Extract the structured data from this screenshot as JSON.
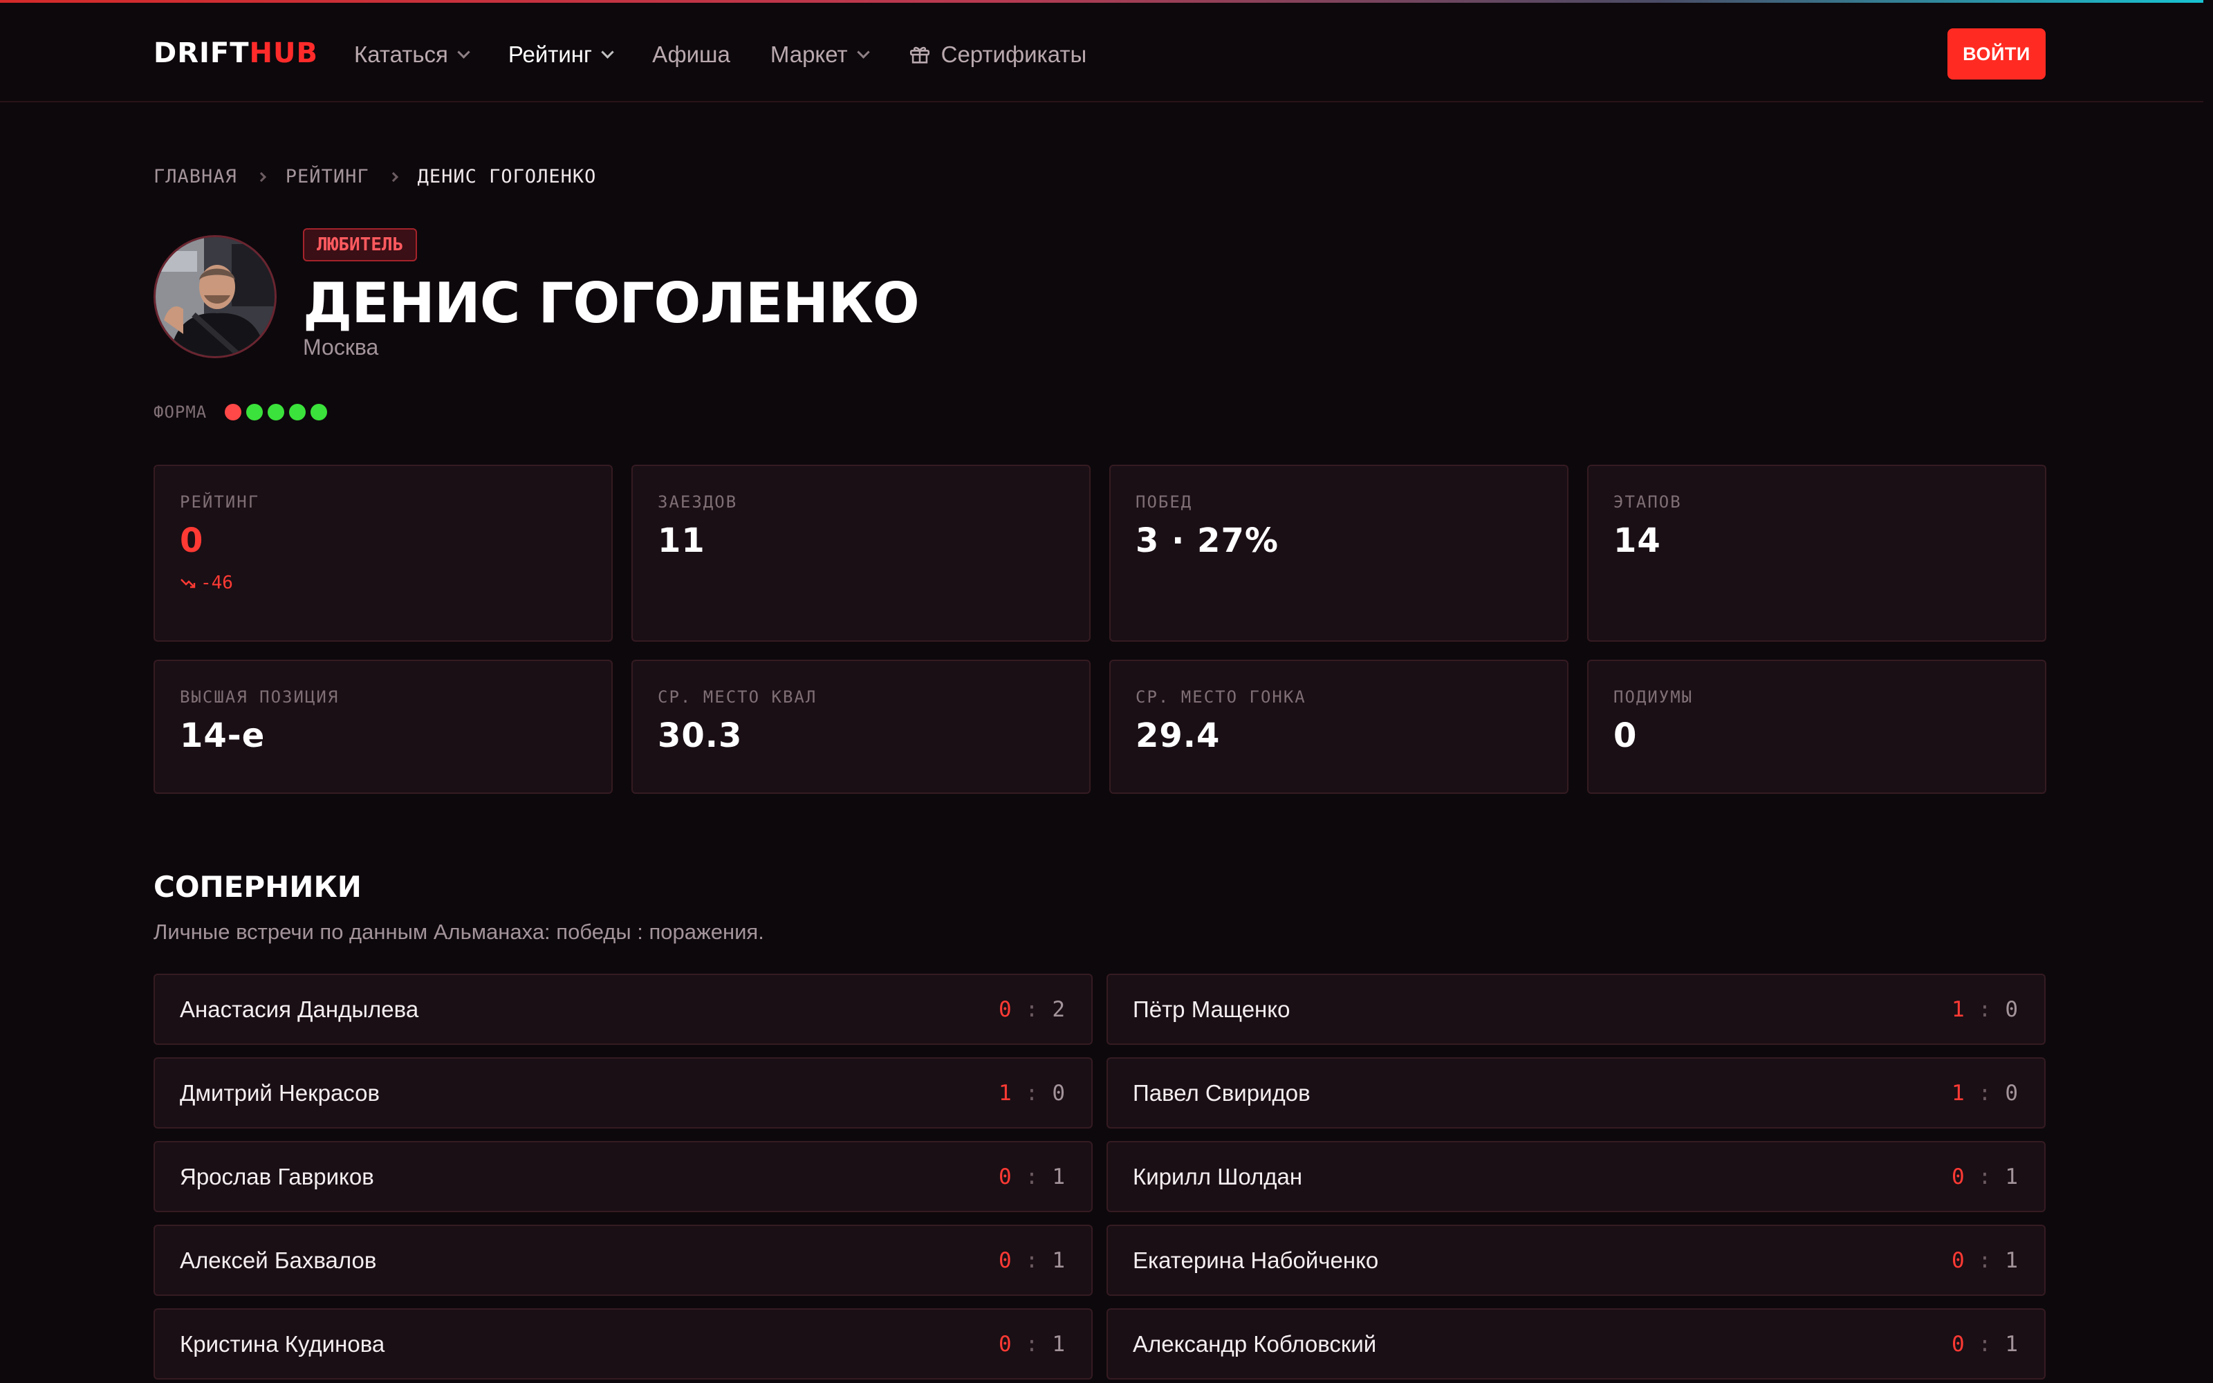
{
  "header": {
    "logo_part1": "DRIFT",
    "logo_part2": "HUB",
    "nav": [
      {
        "label": "Кататься",
        "dropdown": true
      },
      {
        "label": "Рейтинг",
        "dropdown": true,
        "active": true
      },
      {
        "label": "Афиша",
        "dropdown": false
      },
      {
        "label": "Маркет",
        "dropdown": true
      },
      {
        "label": "Сертификаты",
        "icon": "gift-icon"
      }
    ],
    "login_label": "ВОЙТИ"
  },
  "breadcrumb": [
    "ГЛАВНАЯ",
    "РЕЙТИНГ",
    "ДЕНИС ГОГОЛЕНКО"
  ],
  "profile": {
    "badge": "ЛЮБИТЕЛЬ",
    "name": "ДЕНИС ГОГОЛЕНКО",
    "city": "Москва",
    "form_label": "ФОРМА",
    "form": [
      "L",
      "W",
      "W",
      "W",
      "W"
    ]
  },
  "stats": [
    {
      "label": "РЕЙТИНГ",
      "value": "0",
      "accent": true,
      "delta": "-46"
    },
    {
      "label": "ЗАЕЗДОВ",
      "value": "11"
    },
    {
      "label": "ПОБЕД",
      "value": "3 · 27%"
    },
    {
      "label": "ЭТАПОВ",
      "value": "14"
    },
    {
      "label": "ВЫСШАЯ ПОЗИЦИЯ",
      "value": "14-е"
    },
    {
      "label": "СР. МЕСТО КВАЛ",
      "value": "30.3"
    },
    {
      "label": "СР. МЕСТО ГОНКА",
      "value": "29.4"
    },
    {
      "label": "ПОДИУМЫ",
      "value": "0"
    }
  ],
  "rivals_section": {
    "title": "СОПЕРНИКИ",
    "subtitle": "Личные встречи по данным Альманаха: победы : поражения."
  },
  "rivals": [
    {
      "name": "Анастасия Дандылева",
      "wins": "0",
      "losses": "2"
    },
    {
      "name": "Пётр Мащенко",
      "wins": "1",
      "losses": "0"
    },
    {
      "name": "Дмитрий Некрасов",
      "wins": "1",
      "losses": "0"
    },
    {
      "name": "Павел Свиридов",
      "wins": "1",
      "losses": "0"
    },
    {
      "name": "Ярослав Гавриков",
      "wins": "0",
      "losses": "1"
    },
    {
      "name": "Кирилл Шолдан",
      "wins": "0",
      "losses": "1"
    },
    {
      "name": "Алексей Бахвалов",
      "wins": "0",
      "losses": "1"
    },
    {
      "name": "Екатерина Набойченко",
      "wins": "0",
      "losses": "1"
    },
    {
      "name": "Кристина Кудинова",
      "wins": "0",
      "losses": "1"
    },
    {
      "name": "Александр Кобловский",
      "wins": "0",
      "losses": "1"
    }
  ],
  "colors": {
    "accent": "#ff2b22",
    "win": "#3be23b",
    "loss": "#ff4848",
    "background": "#0d080c"
  }
}
